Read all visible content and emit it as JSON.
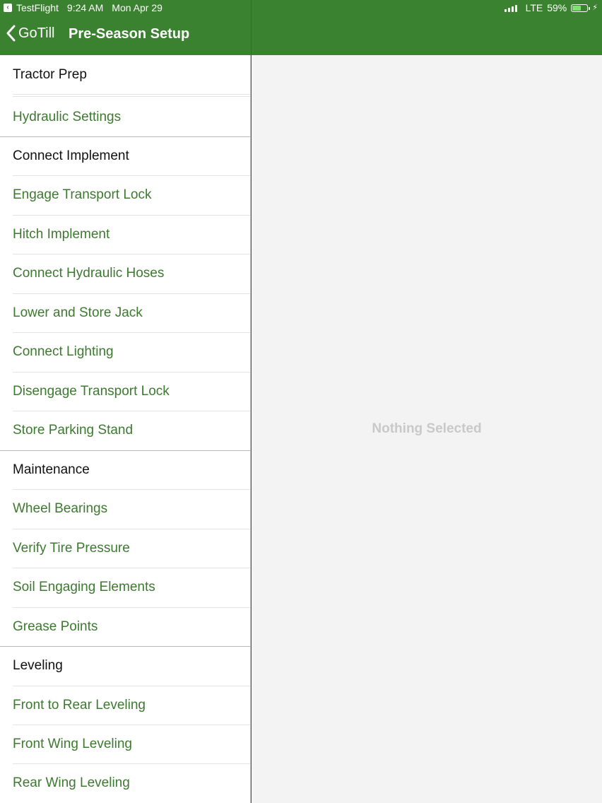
{
  "status_bar": {
    "app": "TestFlight",
    "time": "9:24 AM",
    "date": "Mon Apr 29",
    "network": "LTE",
    "battery_percent": "59%",
    "battery_level": 0.59
  },
  "nav": {
    "back_label": "GoTill",
    "title": "Pre-Season Setup"
  },
  "list": [
    {
      "type": "header",
      "label": "Tractor Prep"
    },
    {
      "type": "item",
      "label": "Hydraulic Settings"
    },
    {
      "type": "header",
      "label": "Connect Implement"
    },
    {
      "type": "item",
      "label": "Engage Transport Lock"
    },
    {
      "type": "item",
      "label": "Hitch Implement"
    },
    {
      "type": "item",
      "label": "Connect Hydraulic Hoses"
    },
    {
      "type": "item",
      "label": "Lower and Store Jack"
    },
    {
      "type": "item",
      "label": "Connect Lighting"
    },
    {
      "type": "item",
      "label": "Disengage Transport Lock"
    },
    {
      "type": "item",
      "label": "Store Parking Stand"
    },
    {
      "type": "header",
      "label": "Maintenance"
    },
    {
      "type": "item",
      "label": "Wheel Bearings"
    },
    {
      "type": "item",
      "label": "Verify Tire Pressure"
    },
    {
      "type": "item",
      "label": "Soil Engaging Elements"
    },
    {
      "type": "item",
      "label": "Grease Points"
    },
    {
      "type": "header",
      "label": "Leveling"
    },
    {
      "type": "item",
      "label": "Front to Rear Leveling"
    },
    {
      "type": "item",
      "label": "Front Wing Leveling"
    },
    {
      "type": "item",
      "label": "Rear Wing Leveling"
    }
  ],
  "detail": {
    "empty_text": "Nothing Selected"
  },
  "colors": {
    "accent": "#3b8230",
    "item_text": "#3c7a2f"
  }
}
